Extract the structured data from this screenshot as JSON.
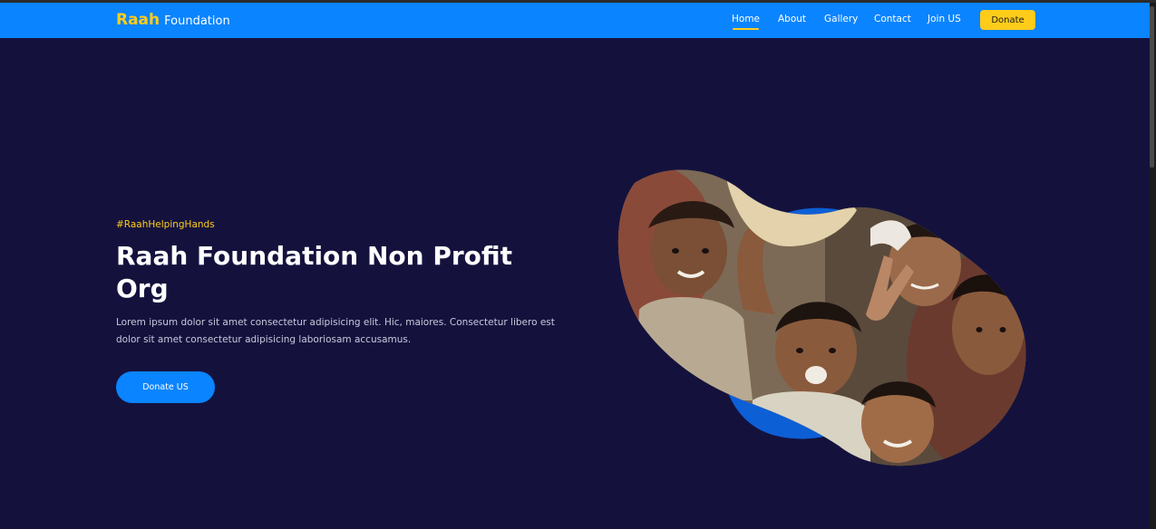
{
  "navbar": {
    "brand_main": "Raah",
    "brand_sub": "Foundation",
    "links": [
      {
        "label": "Home",
        "active": true
      },
      {
        "label": "About",
        "active": false
      },
      {
        "label": "Gallery",
        "active": false
      },
      {
        "label": "Contact",
        "active": false
      },
      {
        "label": "Join US",
        "active": false
      }
    ],
    "donate_label": "Donate"
  },
  "hero": {
    "hashtag": "#RaahHelpingHands",
    "headline": "Raah Foundation Non Profit Org",
    "description": "Lorem ipsum dolor sit amet consectetur adipisicing elit. Hic, maiores. Consectetur libero est dolor sit amet consectetur adipisicing laboriosam accusamus.",
    "cta_label": "Donate US"
  },
  "colors": {
    "background": "#14123d",
    "navbar": "#0a84ff",
    "accent": "#ffcc1a",
    "button": "#0a84ff"
  },
  "icons": {
    "hero_image": "children-photo-blob"
  }
}
